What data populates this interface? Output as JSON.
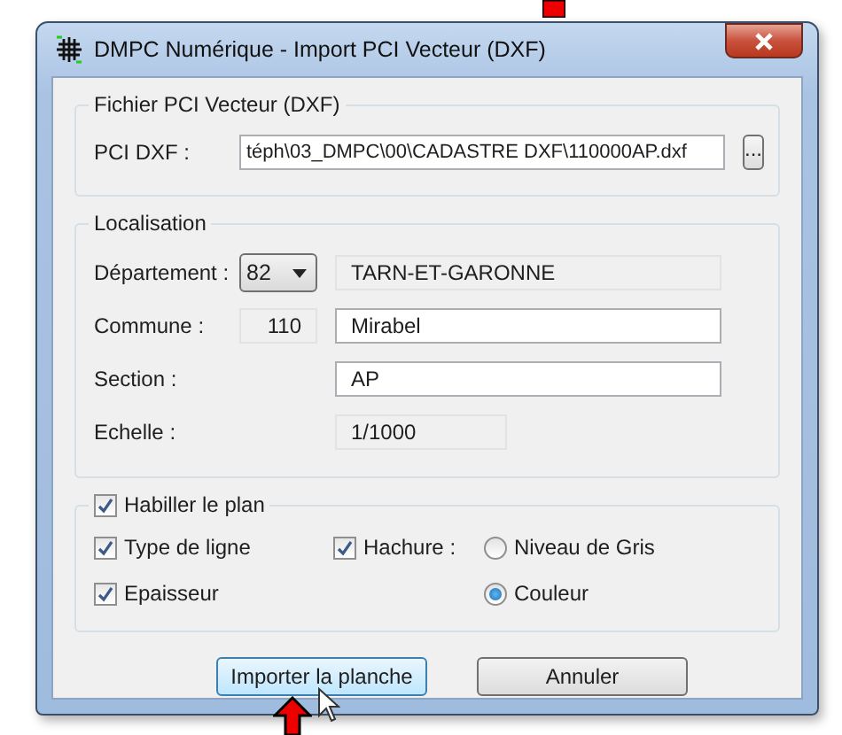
{
  "window": {
    "title": "DMPC Numérique - Import PCI Vecteur (DXF)"
  },
  "file_group": {
    "title": "Fichier PCI Vecteur (DXF)",
    "label": "PCI DXF :",
    "value": "téph\\03_DMPC\\00\\CADASTRE DXF\\110000AP.dxf",
    "browse": "..."
  },
  "location_group": {
    "title": "Localisation",
    "department": {
      "label": "Département :",
      "code": "82",
      "name": "TARN-ET-GARONNE"
    },
    "commune": {
      "label": "Commune :",
      "code": "110",
      "name": "Mirabel"
    },
    "section": {
      "label": "Section :",
      "value": "AP"
    },
    "scale": {
      "label": "Echelle :",
      "value": "1/1000"
    }
  },
  "dress_group": {
    "checkbox": {
      "label": "Habiller le plan",
      "checked": true
    },
    "line_type": {
      "label": "Type de ligne",
      "checked": true
    },
    "hatch": {
      "label": "Hachure :",
      "checked": true
    },
    "thickness": {
      "label": "Epaisseur",
      "checked": true
    },
    "hatch_modes": [
      {
        "label": "Niveau de Gris",
        "selected": false
      },
      {
        "label": "Couleur",
        "selected": true
      }
    ]
  },
  "buttons": [
    {
      "label": "Importer la planche",
      "focused": true
    },
    {
      "label": "Annuler",
      "focused": false
    }
  ]
}
